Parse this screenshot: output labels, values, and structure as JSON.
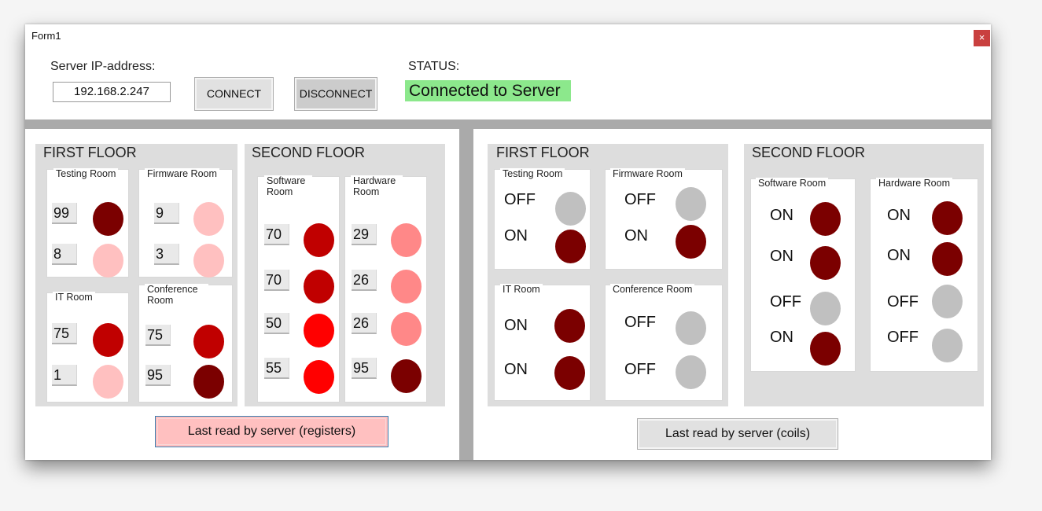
{
  "window": {
    "title": "Form1",
    "close": "×"
  },
  "connection": {
    "ip_label": "Server IP-address:",
    "ip_value": "192.168.2.247",
    "connect": "CONNECT",
    "disconnect": "DISCONNECT",
    "status_label": "STATUS:",
    "status_value": "Connected to Server"
  },
  "colors": {
    "dark": "#7b0000",
    "red": "#c00000",
    "bright": "#ff0000",
    "salmon": "#ff8888",
    "pale": "#ffc0c0",
    "gray": "#c0c0c0",
    "connected": "#8ce88c"
  },
  "registers": {
    "floor1": "FIRST FLOOR",
    "floor2": "SECOND FLOOR",
    "testing": {
      "title": "Testing Room",
      "values": [
        "99",
        "8"
      ]
    },
    "firmware": {
      "title": "Firmware Room",
      "values": [
        "9",
        "3"
      ]
    },
    "it": {
      "title": "IT Room",
      "values": [
        "75",
        "1"
      ]
    },
    "conference": {
      "title": "Conference Room",
      "values": [
        "75",
        "95"
      ]
    },
    "software": {
      "title": "Software Room",
      "values": [
        "70",
        "70",
        "50",
        "55"
      ]
    },
    "hardware": {
      "title": "Hardware Room",
      "values": [
        "29",
        "26",
        "26",
        "95"
      ]
    },
    "button": "Last read by server (registers)"
  },
  "coils": {
    "floor1": "FIRST FLOOR",
    "floor2": "SECOND FLOOR",
    "testing": {
      "title": "Testing Room",
      "states": [
        "OFF",
        "ON"
      ]
    },
    "firmware": {
      "title": "Firmware Room",
      "states": [
        "OFF",
        "ON"
      ]
    },
    "it": {
      "title": "IT Room",
      "states": [
        "ON",
        "ON"
      ]
    },
    "conference": {
      "title": "Conference Room",
      "states": [
        "OFF",
        "OFF"
      ]
    },
    "software": {
      "title": "Software Room",
      "states": [
        "ON",
        "ON",
        "OFF",
        "ON"
      ]
    },
    "hardware": {
      "title": "Hardware Room",
      "states": [
        "ON",
        "ON",
        "OFF",
        "OFF"
      ]
    },
    "button": "Last read by server (coils)"
  }
}
